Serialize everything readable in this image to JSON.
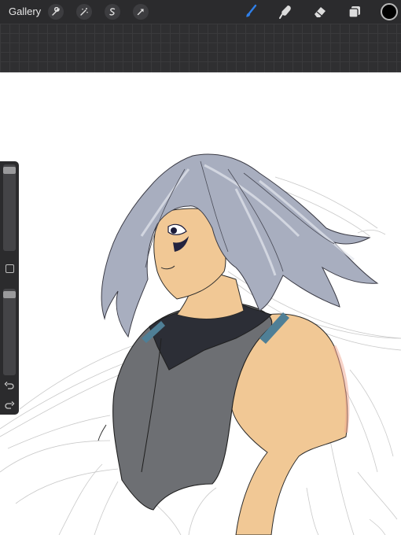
{
  "toolbar": {
    "gallery_label": "Gallery",
    "left_tools": [
      "wrench-icon",
      "magic-wand-icon",
      "selection-icon",
      "transform-arrow-icon"
    ],
    "right_tools": [
      "brush-icon",
      "smudge-icon",
      "eraser-icon",
      "layers-icon"
    ],
    "active_tool": "brush-icon",
    "active_color": "#000000",
    "accent_color": "#2f7fe8"
  },
  "sidebar": {
    "brush_size_level": 0.02,
    "opacity_level": 0.02,
    "modify_button": "square-icon",
    "undo": "undo-icon",
    "redo": "redo-icon"
  },
  "canvas": {
    "background": "#ffffff",
    "artwork": "character-drawing"
  }
}
